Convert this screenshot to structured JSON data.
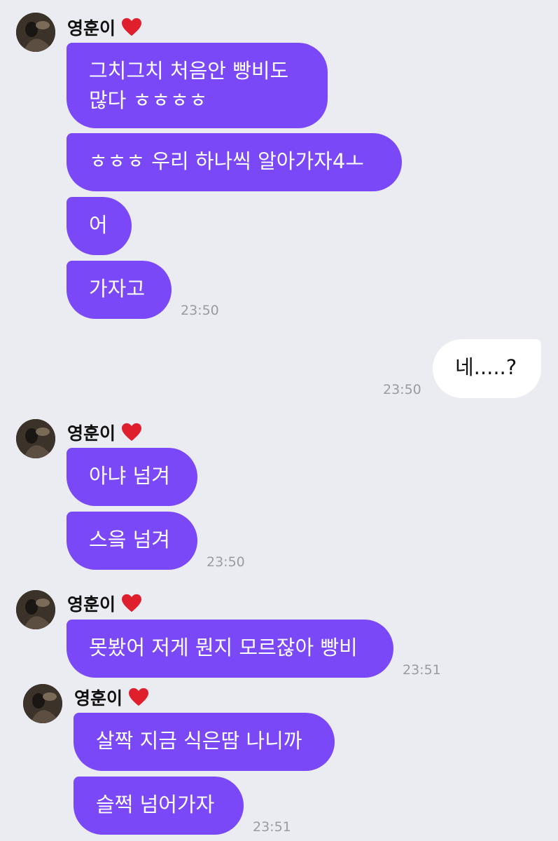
{
  "sender_name": "영훈이",
  "heart_icon": "red-heart-icon",
  "colors": {
    "background": "#ebecf1",
    "incoming_bubble": "#7b48f8",
    "outgoing_bubble": "#ffffff",
    "timestamp": "#9a9ba1"
  },
  "groups": [
    {
      "messages": [
        "그치그치 처음안 빵비도\n많다 ㅎㅎㅎㅎ",
        "ㅎㅎㅎ 우리 하나씩 알아가자4ㅗ",
        "어",
        "가자고"
      ],
      "time": "23:50"
    },
    {
      "outgoing": true,
      "messages": [
        "네.....?"
      ],
      "time": "23:50"
    },
    {
      "messages": [
        "아냐 넘겨",
        "스읔 넘겨"
      ],
      "time": "23:50"
    },
    {
      "messages": [
        "못봤어 저게 뭔지 모르잖아 빵비"
      ],
      "time": "23:51"
    },
    {
      "messages": [
        "살짝 지금 식은땀 나니까",
        "슬쩍 넘어가자"
      ],
      "time": "23:51"
    }
  ]
}
